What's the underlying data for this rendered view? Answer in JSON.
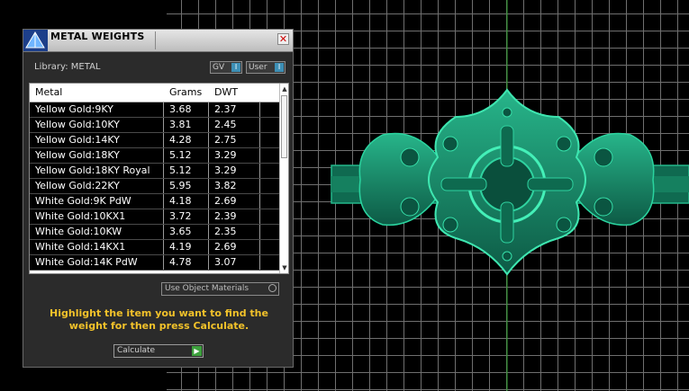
{
  "dialog": {
    "title": "METAL WEIGHTS",
    "close_glyph": "✕",
    "library_label": "Library: METAL",
    "toggles": [
      {
        "label": "GV",
        "knob": "I"
      },
      {
        "label": "User",
        "knob": "I"
      }
    ],
    "table": {
      "headers": [
        "Metal",
        "Grams",
        "DWT"
      ],
      "rows": [
        [
          "Yellow Gold:9KY",
          "3.68",
          "2.37"
        ],
        [
          "Yellow Gold:10KY",
          "3.81",
          "2.45"
        ],
        [
          "Yellow Gold:14KY",
          "4.28",
          "2.75"
        ],
        [
          "Yellow Gold:18KY",
          "5.12",
          "3.29"
        ],
        [
          "Yellow Gold:18KY Royal",
          "5.12",
          "3.29"
        ],
        [
          "Yellow Gold:22KY",
          "5.95",
          "3.82"
        ],
        [
          "White Gold:9K PdW",
          "4.18",
          "2.69"
        ],
        [
          "White Gold:10KX1",
          "3.72",
          "2.39"
        ],
        [
          "White Gold:10KW",
          "3.65",
          "2.35"
        ],
        [
          "White Gold:14KX1",
          "4.19",
          "2.69"
        ],
        [
          "White Gold:14K PdW",
          "4.78",
          "3.07"
        ]
      ]
    },
    "use_object_materials_label": "Use Object Materials",
    "instructions": "Highlight the item you want to find the weight for then press Calculate.",
    "calculate_label": "Calculate",
    "calculate_icon": "play-icon"
  },
  "viewport": {
    "grid_color": "#6f6f6f",
    "model_color": "#1a8a6a",
    "axis_color": "#2aa02a"
  }
}
